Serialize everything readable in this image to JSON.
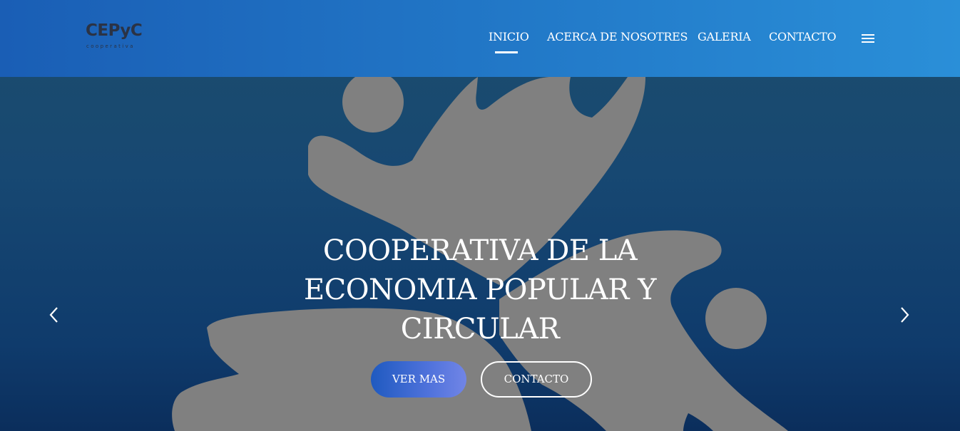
{
  "header": {
    "logo": {
      "name": "CEPyC",
      "sub": "cooperativa"
    },
    "nav": [
      {
        "label": "INICIO",
        "active": true
      },
      {
        "label": "ACERCA DE NOSOTRES",
        "active": false
      },
      {
        "label": "GALERIA",
        "active": false
      },
      {
        "label": "CONTACTO",
        "active": false
      }
    ],
    "menu_icon": "hamburger-menu-icon"
  },
  "hero": {
    "title": "COOPERATIVA DE LA ECONOMIA POPULAR Y CIRCULAR",
    "primary_button": "VER MAS",
    "secondary_button": "CONTACTO",
    "prev_icon": "chevron-left-icon",
    "next_icon": "chevron-right-icon"
  },
  "colors": {
    "header_start": "#1a5eb5",
    "header_end": "#2a8fd8",
    "hero_bg": "#174872",
    "shape_gray": "#808080",
    "text": "#ffffff",
    "logo_text": "#2b3345"
  }
}
